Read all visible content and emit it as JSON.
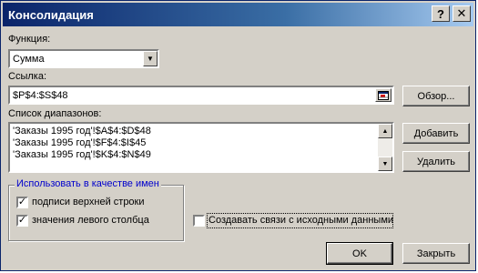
{
  "window": {
    "title": "Консолидация",
    "help_glyph": "?",
    "close_glyph": "✕"
  },
  "function": {
    "label": "Функция:",
    "value": "Сумма"
  },
  "reference": {
    "label": "Ссылка:",
    "value": "$P$4:$S$48",
    "browse_label": "Обзор..."
  },
  "ranges": {
    "label": "Список диапазонов:",
    "items": [
      "'Заказы 1995 год'!$A$4:$D$48",
      "'Заказы 1995 год'!$F$4:$I$45",
      "'Заказы 1995 год'!$K$4:$N$49"
    ],
    "add_label": "Добавить",
    "delete_label": "Удалить"
  },
  "use_labels": {
    "legend": "Использовать в качестве имен",
    "top_row": {
      "label": "подписи верхней строки",
      "checked": true
    },
    "left_column": {
      "label": "значения левого столбца",
      "checked": true
    }
  },
  "create_links": {
    "label": "Создавать связи с исходными данными",
    "checked": false
  },
  "buttons": {
    "ok": "OK",
    "close": "Закрыть"
  }
}
